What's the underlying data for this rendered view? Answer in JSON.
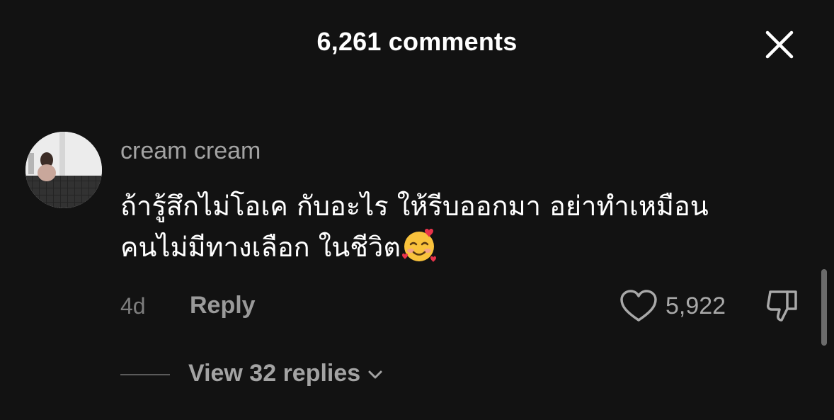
{
  "header": {
    "title": "6,261 comments",
    "close_icon": "close-icon"
  },
  "comment": {
    "username": "cream cream",
    "text_line1": "ถ้ารู้สึกไม่โอเค กับอะไร ให้รีบออกมา อย่าทำเหมือน",
    "text_line2": "คนไม่มีทางเลือก ในชีวิต",
    "emoji": "smiling-face-with-hearts-icon",
    "time": "4d",
    "reply_label": "Reply",
    "like_count": "5,922",
    "view_replies_label": "View 32 replies"
  },
  "colors": {
    "background": "#121212",
    "primary_text": "#ffffff",
    "secondary_text": "#a3a3a3",
    "muted_text": "#7d7d7d"
  }
}
